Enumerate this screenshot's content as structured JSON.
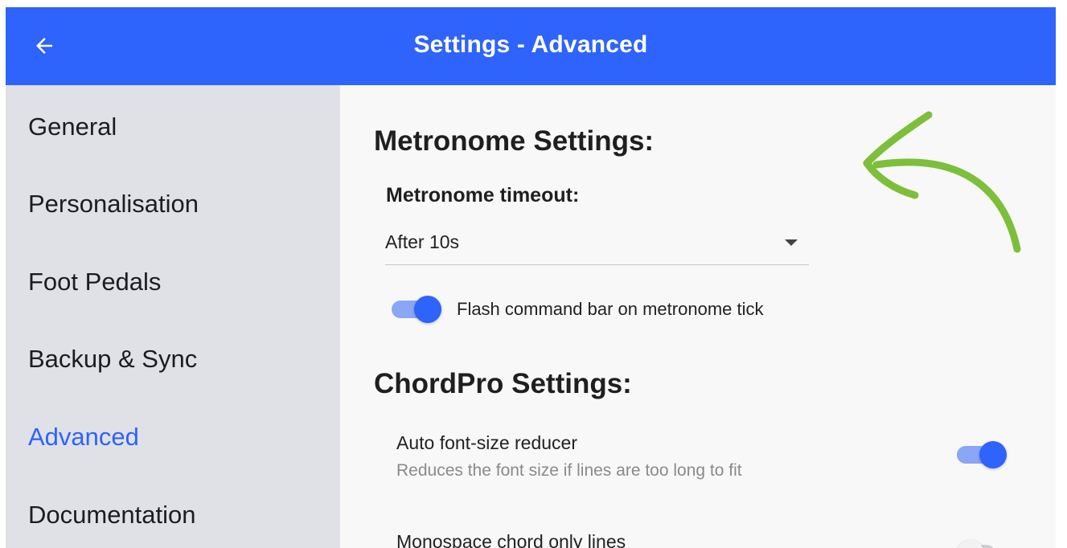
{
  "appbar": {
    "title": "Settings - Advanced",
    "back_icon": "arrow-left-icon",
    "color": "#2e63fc"
  },
  "sidebar": {
    "items": [
      {
        "label": "General",
        "active": false
      },
      {
        "label": "Personalisation",
        "active": false
      },
      {
        "label": "Foot Pedals",
        "active": false
      },
      {
        "label": "Backup & Sync",
        "active": false
      },
      {
        "label": "Advanced",
        "active": true
      },
      {
        "label": "Documentation",
        "active": false
      }
    ]
  },
  "metronome": {
    "heading": "Metronome Settings:",
    "timeout_label": "Metronome timeout:",
    "timeout_value": "After 10s",
    "flash_label": "Flash command bar on metronome tick",
    "flash_enabled": true
  },
  "chordpro": {
    "heading": "ChordPro Settings:",
    "auto_font": {
      "title": "Auto font-size reducer",
      "subtitle": "Reduces the font size if lines are too long to fit",
      "enabled": true
    },
    "monospace": {
      "title": "Monospace chord only lines",
      "enabled": false
    }
  },
  "annotation": {
    "icon": "hand-drawn-arrow-icon",
    "color": "#7dbf3a"
  }
}
